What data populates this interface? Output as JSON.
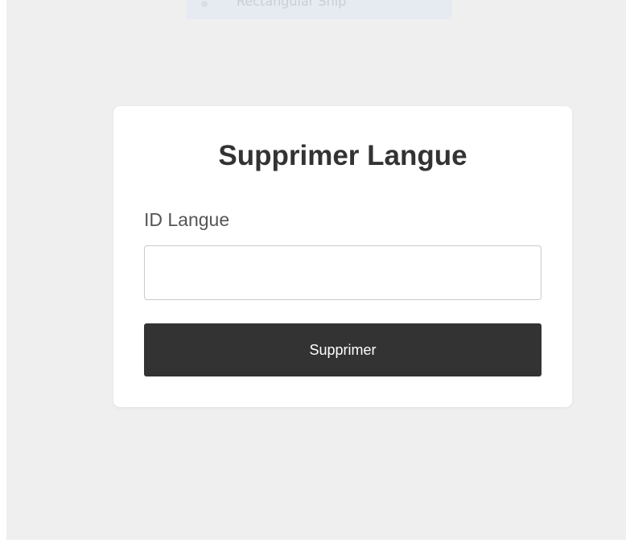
{
  "snip_toolbar": {
    "label": "Rectangular Snip",
    "icon": "record-dot-icon"
  },
  "form": {
    "title": "Supprimer Langue",
    "field_label": "ID Langue",
    "field_value": "",
    "field_placeholder": "",
    "submit_label": "Supprimer"
  },
  "colors": {
    "page_background": "#efefef",
    "card_background": "#ffffff",
    "button_background": "#333333",
    "button_text": "#ffffff",
    "title_text": "#333333"
  }
}
